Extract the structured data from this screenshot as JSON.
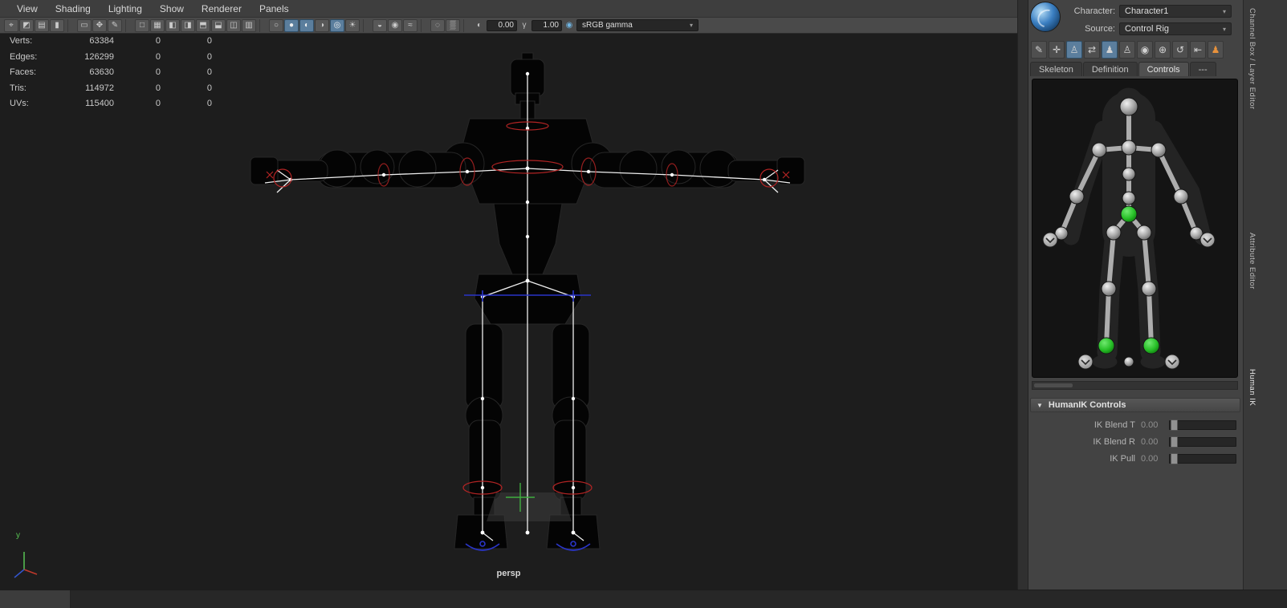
{
  "menu_bar": {
    "items": [
      "View",
      "Shading",
      "Lighting",
      "Show",
      "Renderer",
      "Panels"
    ]
  },
  "ui": {
    "dropdown_arrow": "▾",
    "collapse_arrow": "▼"
  },
  "viewport_toolbar": {
    "icons": [
      {
        "name": "select-camera",
        "glyph": "⌖"
      },
      {
        "name": "lock-camera",
        "glyph": "◩"
      },
      {
        "name": "camera-attributes",
        "glyph": "▤"
      },
      {
        "name": "bookmarks",
        "glyph": "▮"
      },
      {
        "name": "image-plane",
        "glyph": "▭"
      },
      {
        "name": "2d-pan-zoom",
        "glyph": "✥"
      },
      {
        "name": "grease-pencil",
        "glyph": "✎"
      },
      {
        "name": "layout-single",
        "glyph": "□"
      },
      {
        "name": "layout-four-view",
        "glyph": "▦"
      },
      {
        "name": "layout-split-left",
        "glyph": "◧"
      },
      {
        "name": "layout-split-right",
        "glyph": "◨"
      },
      {
        "name": "layout-split-top",
        "glyph": "⬒"
      },
      {
        "name": "layout-split-bottom",
        "glyph": "⬓"
      },
      {
        "name": "layout-outliner",
        "glyph": "◫"
      },
      {
        "name": "layout-hypershade",
        "glyph": "▥"
      },
      {
        "name": "wireframe-display",
        "glyph": "○"
      },
      {
        "name": "smooth-shade",
        "glyph": "●",
        "active": true
      },
      {
        "name": "textured",
        "glyph": "◐",
        "active": true
      },
      {
        "name": "use-default-material",
        "glyph": "◑"
      },
      {
        "name": "wireframe-on-shaded",
        "glyph": "◎",
        "active": true
      },
      {
        "name": "lighting-all",
        "glyph": "☀"
      },
      {
        "name": "shadows",
        "glyph": "◒"
      },
      {
        "name": "screen-space-ao",
        "glyph": "◉"
      },
      {
        "name": "motion-blur",
        "glyph": "≈"
      },
      {
        "name": "isolate-select",
        "glyph": "◌"
      },
      {
        "name": "xray",
        "glyph": "▒"
      }
    ],
    "exposure_icon": "◐",
    "exposure_value": "0.00",
    "gamma_icon": "γ",
    "gamma_value": "1.00",
    "colorspace_icon": "◉",
    "colorspace": "sRGB gamma"
  },
  "hud": {
    "rows": [
      {
        "label": "Verts:",
        "value": "63384",
        "col2": "0",
        "col3": "0"
      },
      {
        "label": "Edges:",
        "value": "126299",
        "col2": "0",
        "col3": "0"
      },
      {
        "label": "Faces:",
        "value": "63630",
        "col2": "0",
        "col3": "0"
      },
      {
        "label": "Tris:",
        "value": "114972",
        "col2": "0",
        "col3": "0"
      },
      {
        "label": "UVs:",
        "value": "115400",
        "col2": "0",
        "col3": "0"
      }
    ],
    "camera_label": "persp",
    "axis_label_y": "y"
  },
  "right_panel": {
    "character_label": "Character:",
    "character_value": "Character1",
    "source_label": "Source:",
    "source_value": "Control Rig",
    "toolbar_icons": [
      {
        "name": "character-pencil",
        "glyph": "✎"
      },
      {
        "name": "ik-pose-pen",
        "glyph": "✛"
      },
      {
        "name": "stance-pose",
        "glyph": "♙",
        "active": true
      },
      {
        "name": "mirror-pose",
        "glyph": "⇄"
      },
      {
        "name": "full-body-key",
        "glyph": "♟",
        "active": true
      },
      {
        "name": "body-part-key",
        "glyph": "♙"
      },
      {
        "name": "selection-key",
        "glyph": "◉"
      },
      {
        "name": "pin-translate",
        "glyph": "⊕"
      },
      {
        "name": "pin-rotate",
        "glyph": "↺"
      },
      {
        "name": "go-to-stance",
        "glyph": "⇤"
      },
      {
        "name": "character-person",
        "glyph": "♟",
        "tint": "orange"
      }
    ],
    "tabs": [
      {
        "label": "Skeleton"
      },
      {
        "label": "Definition"
      },
      {
        "label": "Controls",
        "active": true
      },
      {
        "label": "---"
      }
    ],
    "humanik_controls": {
      "title": "HumanIK Controls",
      "sliders": [
        {
          "label": "IK Blend T",
          "value": "0.00"
        },
        {
          "label": "IK Blend R",
          "value": "0.00"
        },
        {
          "label": "IK Pull",
          "value": "0.00"
        }
      ]
    }
  },
  "side_tabs": [
    {
      "label": "Channel Box / Layer Editor"
    },
    {
      "label": "Attribute Editor"
    },
    {
      "label": "Human IK"
    }
  ],
  "colors": {
    "accent_blue": "#5b7e9d",
    "joint_green": "#35c835",
    "control_red": "#b32424",
    "control_blue": "#2a35c8",
    "axis_green": "#58c554",
    "viewport_bg": "#1d1d1d",
    "panel_bg": "#434343"
  }
}
